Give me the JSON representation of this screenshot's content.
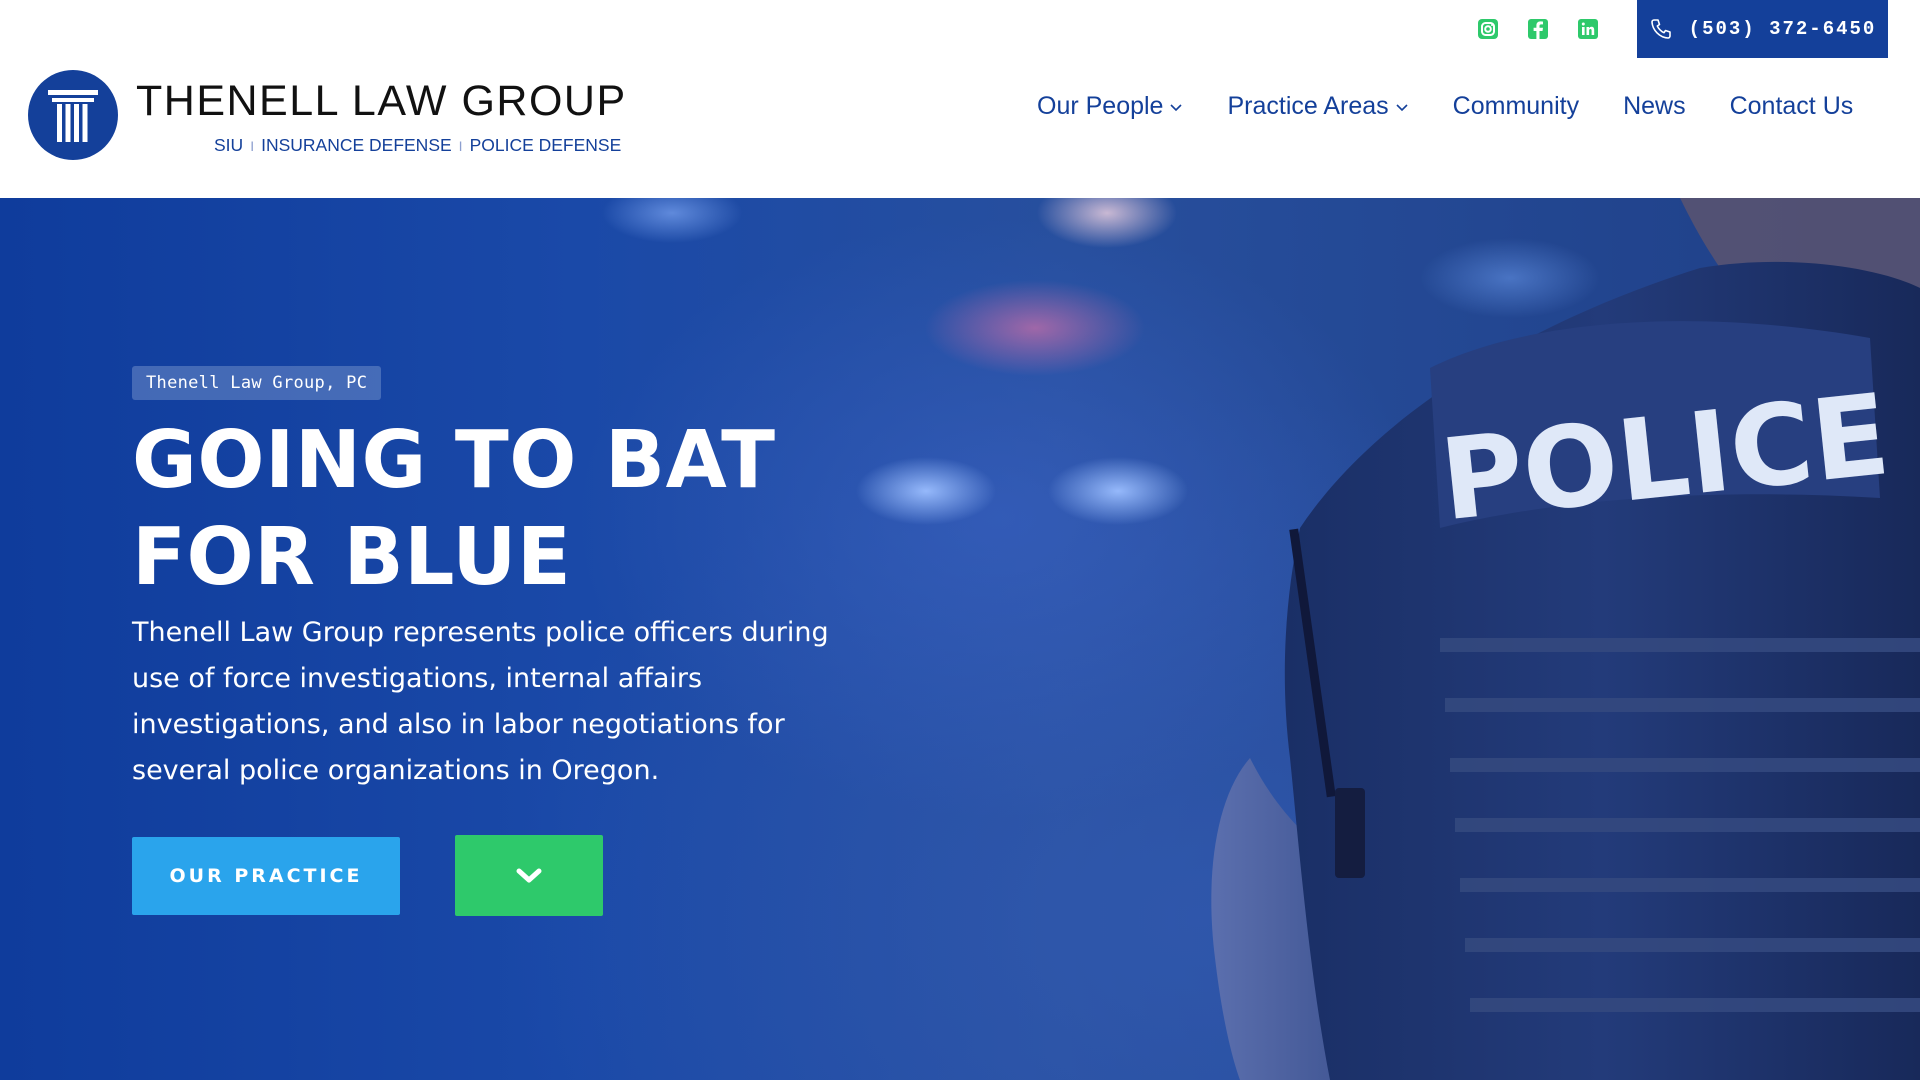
{
  "brand": {
    "name": "THENELL LAW GROUP",
    "tagline": [
      "SIU",
      "INSURANCE DEFENSE",
      "POLICE DEFENSE"
    ],
    "tagline_separator": "I",
    "color": "#14409a"
  },
  "header": {
    "socials": [
      {
        "name": "instagram-icon",
        "color": "#2ec96b"
      },
      {
        "name": "facebook-icon",
        "color": "#2ec96b"
      },
      {
        "name": "linkedin-icon",
        "color": "#2ec96b"
      }
    ],
    "phone": "(503) 372-6450"
  },
  "nav": {
    "items": [
      {
        "label": "Our People",
        "has_dropdown": true
      },
      {
        "label": "Practice Areas",
        "has_dropdown": true
      },
      {
        "label": "Community",
        "has_dropdown": false
      },
      {
        "label": "News",
        "has_dropdown": false
      },
      {
        "label": "Contact Us",
        "has_dropdown": false
      }
    ]
  },
  "hero": {
    "kicker": "Thenell Law Group, PC",
    "headline_line1": "GOING TO BAT",
    "headline_line2": "FOR BLUE",
    "body": "Thenell Law Group represents police officers during use of force investigations, internal affairs investigations, and also in labor negotiations for several police organizations in Oregon.",
    "cta_label": "OUR PRACTICE",
    "scroll_icon": "chevron-down-icon",
    "vest_text": "POLICE",
    "colors": {
      "cta": "#2aa4ec",
      "scroll": "#2ec96b",
      "overlay": "#1a49a8"
    }
  }
}
